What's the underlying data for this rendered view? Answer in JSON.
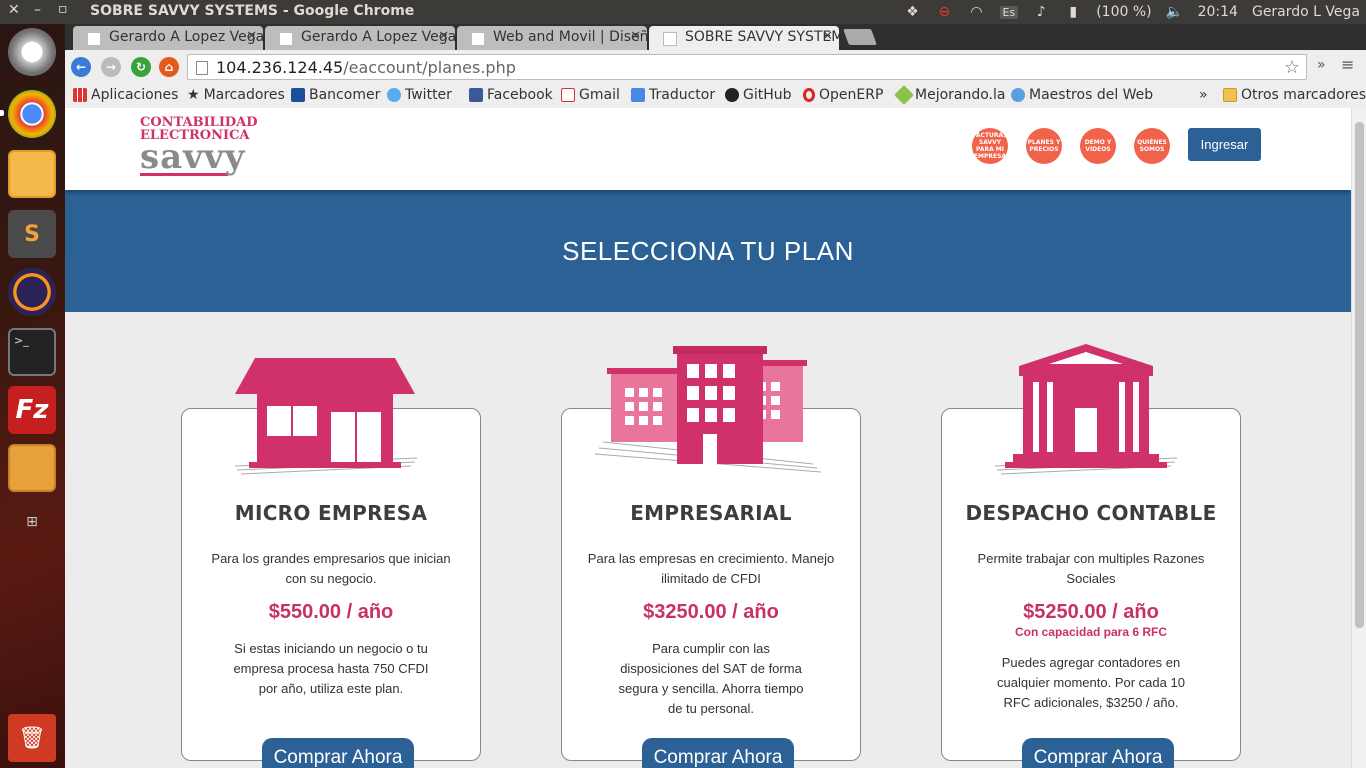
{
  "window": {
    "title": "SOBRE SAVVY SYSTEMS - Google Chrome"
  },
  "tray": {
    "battery": "(100 %)",
    "time": "20:14",
    "user": "Gerardo L Vega",
    "keyboard": "Es"
  },
  "tabs": [
    {
      "label": "Gerardo A Lopez Vega"
    },
    {
      "label": "Gerardo A Lopez Vega"
    },
    {
      "label": "Web and Movil | Diseñ"
    },
    {
      "label": "SOBRE SAVVY SYSTEM"
    }
  ],
  "omnibox": {
    "host": "104.236.124.45",
    "path": "/eaccount/planes.php"
  },
  "bookmarks": {
    "items": [
      {
        "label": "Aplicaciones"
      },
      {
        "label": "Marcadores"
      },
      {
        "label": "Bancomer"
      },
      {
        "label": "Twitter"
      },
      {
        "label": "Facebook"
      },
      {
        "label": "Gmail"
      },
      {
        "label": "Traductor"
      },
      {
        "label": "GitHub"
      },
      {
        "label": "OpenERP"
      },
      {
        "label": "Mejorando.la"
      },
      {
        "label": "Maestros del Web"
      }
    ],
    "more": "»",
    "other": "Otros marcadores"
  },
  "site": {
    "logo": {
      "line1": "CONTABILIDAD",
      "line2": "ELECTRONICA",
      "line3": "savvy"
    },
    "nav": [
      {
        "label": "FACTURAS SAVVY PARA MI EMPRESA"
      },
      {
        "label": "PLANES Y PRECIOS"
      },
      {
        "label": "DEMO Y VIDEOS"
      },
      {
        "label": "QUIÉNES SOMOS"
      }
    ],
    "login": "Ingresar",
    "hero_title": "SELECCIONA TU PLAN"
  },
  "plans": [
    {
      "name": "MICRO EMPRESA",
      "description": "Para los grandes empresarios que inician con su negocio.",
      "price": "$550.00 / año",
      "note": "Si estas iniciando un negocio o tu empresa procesa hasta 750 CFDI por año, utiliza este plan.",
      "cta": "Comprar Ahora"
    },
    {
      "name": "EMPRESARIAL",
      "description": "Para las empresas en crecimiento. Manejo ilimitado de CFDI",
      "price": "$3250.00 / año",
      "note": "Para cumplir con las disposiciones del SAT de forma segura y sencilla. Ahorra tiempo de tu personal.",
      "cta": "Comprar Ahora"
    },
    {
      "name": "DESPACHO CONTABLE",
      "description": "Permite trabajar con multiples Razones Sociales",
      "price": "$5250.00 / año",
      "capacity": "Con capacidad para 6 RFC",
      "note": "Puedes agregar contadores en cualquier momento. Por cada 10 RFC adicionales, $3250 / año.",
      "cta": "Comprar Ahora"
    }
  ],
  "colors": {
    "brand_pink": "#d0316b",
    "brand_blue": "#2b6195",
    "nav_orange": "#f0624a"
  }
}
